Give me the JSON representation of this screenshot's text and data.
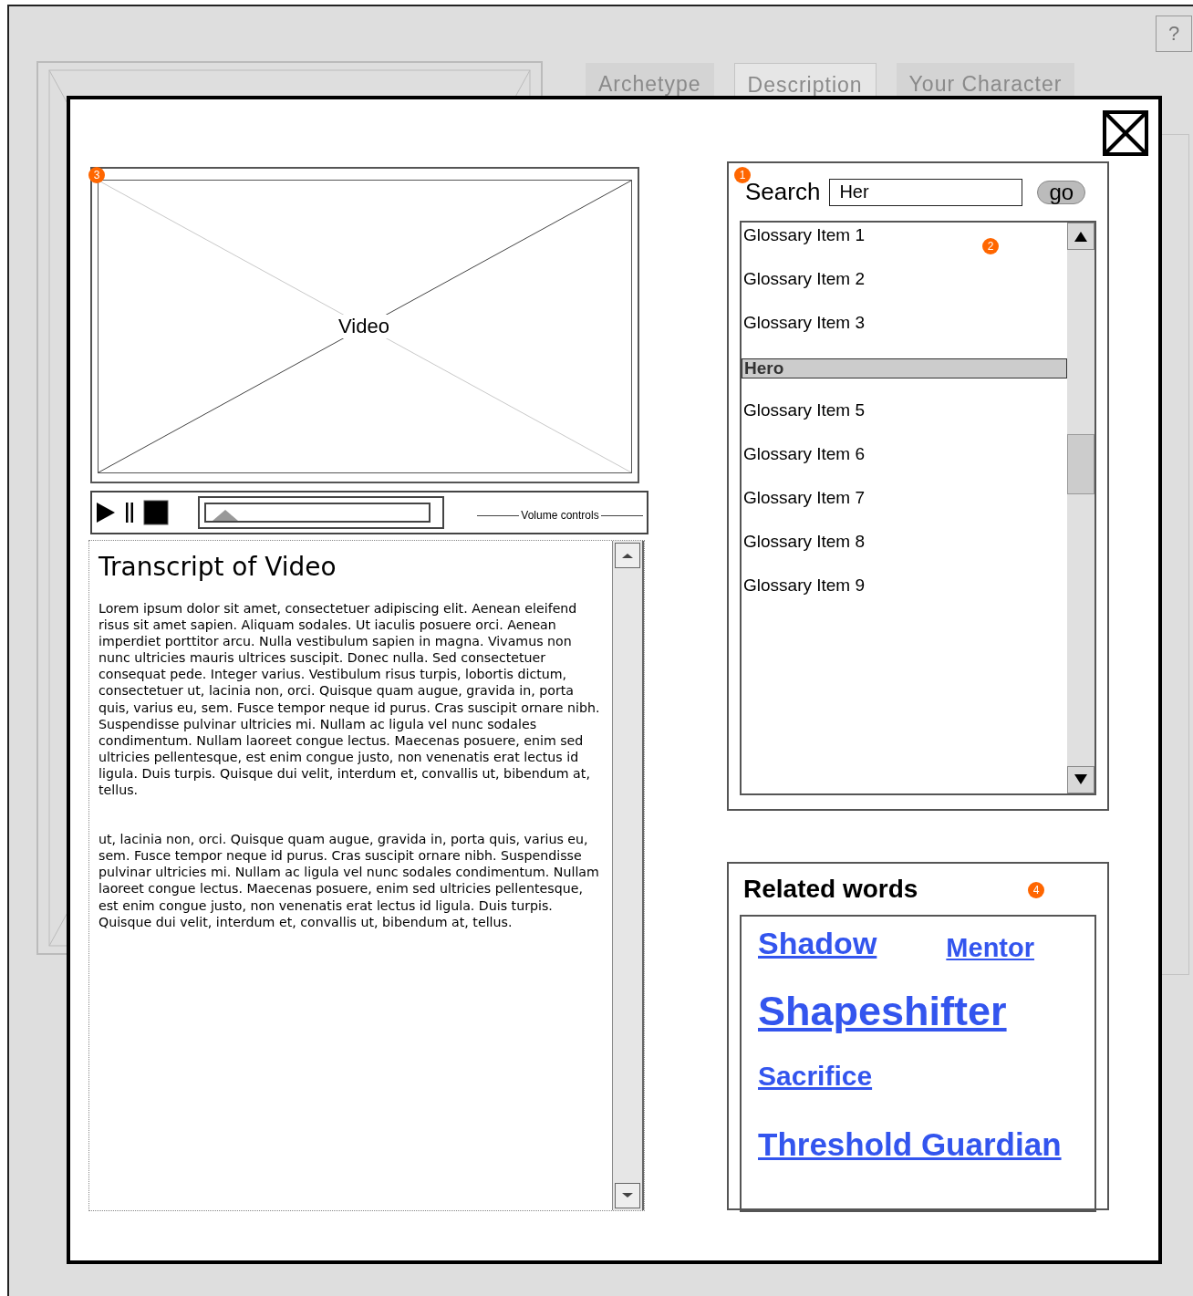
{
  "background": {
    "tabs": [
      {
        "label": "Archetype",
        "selected": false
      },
      {
        "label": "Description",
        "selected": true
      },
      {
        "label": "Your Character",
        "selected": false
      }
    ],
    "help": "?"
  },
  "video": {
    "label": "Video",
    "annotation": "3"
  },
  "player": {
    "level": 0.03,
    "volume_label": "Volume controls"
  },
  "transcript": {
    "title": "Transcript of Video",
    "paragraphs": [
      "Lorem ipsum dolor sit amet, consectetuer adipiscing elit. Aenean eleifend risus sit amet sapien. Aliquam sodales. Ut iaculis posuere orci. Aenean imperdiet porttitor arcu. Nulla vestibulum sapien in magna. Vivamus non nunc ultricies mauris ultrices suscipit. Donec nulla. Sed consectetuer consequat pede. Integer varius. Vestibulum risus turpis, lobortis dictum, consectetuer ut, lacinia non, orci. Quisque quam augue, gravida in, porta quis, varius eu, sem. Fusce tempor neque id purus. Cras suscipit ornare nibh. Suspendisse pulvinar ultricies mi. Nullam ac ligula vel nunc sodales condimentum. Nullam laoreet congue lectus. Maecenas posuere, enim sed ultricies pellentesque, est enim congue justo, non venenatis erat lectus id ligula. Duis turpis. Quisque dui velit, interdum et, convallis ut, bibendum at, tellus.",
      "ut, lacinia non, orci. Quisque quam augue, gravida in, porta quis, varius eu, sem. Fusce tempor neque id purus. Cras suscipit ornare nibh. Suspendisse pulvinar ultricies mi. Nullam ac ligula vel nunc sodales condimentum. Nullam laoreet congue lectus. Maecenas posuere, enim sed ultricies pellentesque, est enim congue justo, non venenatis erat lectus id ligula. Duis turpis. Quisque dui velit, interdum et, convallis ut, bibendum at, tellus."
    ]
  },
  "search": {
    "annotation": "1",
    "label": "Search",
    "value": "Her",
    "button": "go"
  },
  "glossary": {
    "annotation": "2",
    "items": [
      {
        "label": "Glossary Item 1",
        "selected": false
      },
      {
        "label": "Glossary Item 2",
        "selected": false
      },
      {
        "label": "Glossary Item 3",
        "selected": false
      },
      {
        "label": "Hero",
        "selected": true
      },
      {
        "label": "Glossary Item 5",
        "selected": false
      },
      {
        "label": "Glossary Item 6",
        "selected": false
      },
      {
        "label": "Glossary Item 7",
        "selected": false
      },
      {
        "label": "Glossary Item 8",
        "selected": false
      },
      {
        "label": "Glossary Item 9",
        "selected": false
      }
    ]
  },
  "related": {
    "annotation": "4",
    "title": "Related words",
    "links": [
      "Shadow",
      "Mentor",
      "Shapeshifter",
      "Sacrifice",
      "Threshold Guardian"
    ]
  }
}
